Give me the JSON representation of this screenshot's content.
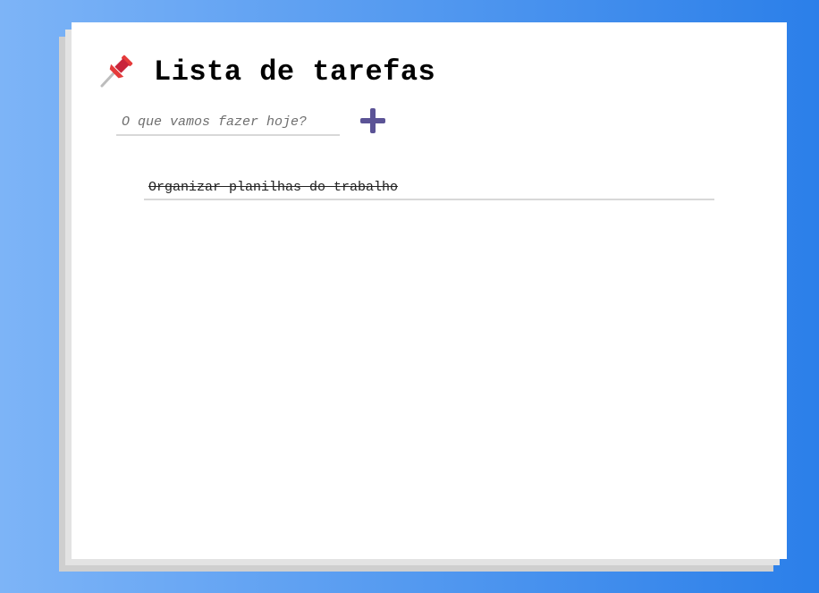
{
  "app": {
    "title": "Lista de tarefas",
    "title_icon": "pushpin-icon"
  },
  "form": {
    "placeholder": "O que vamos fazer hoje?",
    "value": "",
    "add_icon": "plus-icon",
    "add_icon_color": "#5b5396"
  },
  "tasks": [
    {
      "text": "Organizar planilhas do trabalho",
      "done": true
    }
  ],
  "colors": {
    "background_gradient_start": "#7db4f7",
    "background_gradient_end": "#2b7fe9",
    "card": "#ffffff",
    "pin_red": "#e53b3b"
  }
}
